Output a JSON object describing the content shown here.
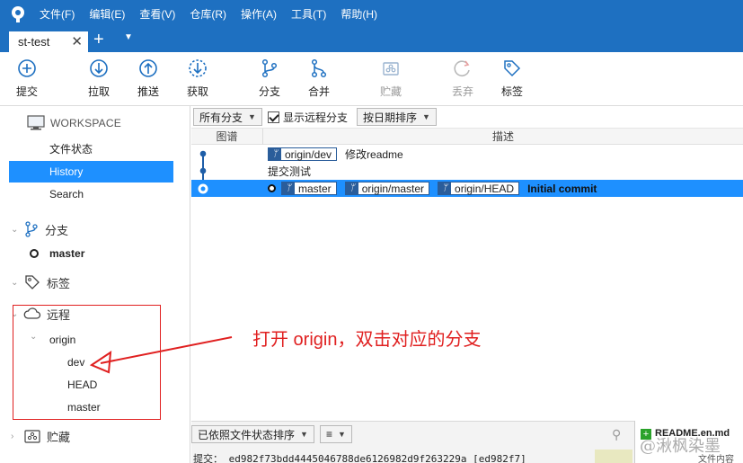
{
  "menu": [
    "文件(F)",
    "编辑(E)",
    "查看(V)",
    "仓库(R)",
    "操作(A)",
    "工具(T)",
    "帮助(H)"
  ],
  "tab": {
    "title": "st-test",
    "close": "✕",
    "add": "+",
    "menu": "▼"
  },
  "toolbar": {
    "commit": "提交",
    "pull": "拉取",
    "push": "推送",
    "fetch": "获取",
    "branch": "分支",
    "merge": "合并",
    "stash": "贮藏",
    "discard": "丢弃",
    "tag": "标签"
  },
  "sidebar": {
    "workspace": "WORKSPACE",
    "file_status": "文件状态",
    "history": "History",
    "search": "Search",
    "branches": "分支",
    "branch_master": "master",
    "tags": "标签",
    "remotes": "远程",
    "origin": "origin",
    "remote_branches": [
      "dev",
      "HEAD",
      "master"
    ],
    "stashes": "贮藏"
  },
  "filters": {
    "all_branches": "所有分支",
    "show_remote": "显示远程分支",
    "order": "按日期排序"
  },
  "columns": {
    "graph": "图谱",
    "description": "描述"
  },
  "commits": [
    {
      "tags": [
        "origin/dev"
      ],
      "message": "修改readme"
    },
    {
      "tags": [],
      "message": "提交测试"
    },
    {
      "tags": [
        "master",
        "origin/master",
        "origin/HEAD"
      ],
      "message": "Initial commit"
    }
  ],
  "annotation": "打开 origin，双击对应的分支",
  "bottom": {
    "sort": "已依照文件状态排序",
    "list_icon": "≡",
    "commit_line": "提交： ed982f73bdd4445046788de6126982d9f263229a [ed982f7]",
    "file_name": "README.en.md",
    "file_content": "文件内容",
    "watermark": "@湫枫染墨"
  },
  "colors": {
    "titlebar": "#1e70c1",
    "selected": "#1e90ff",
    "tag_border": "#2a5d9a",
    "annotation": "#e02020"
  }
}
